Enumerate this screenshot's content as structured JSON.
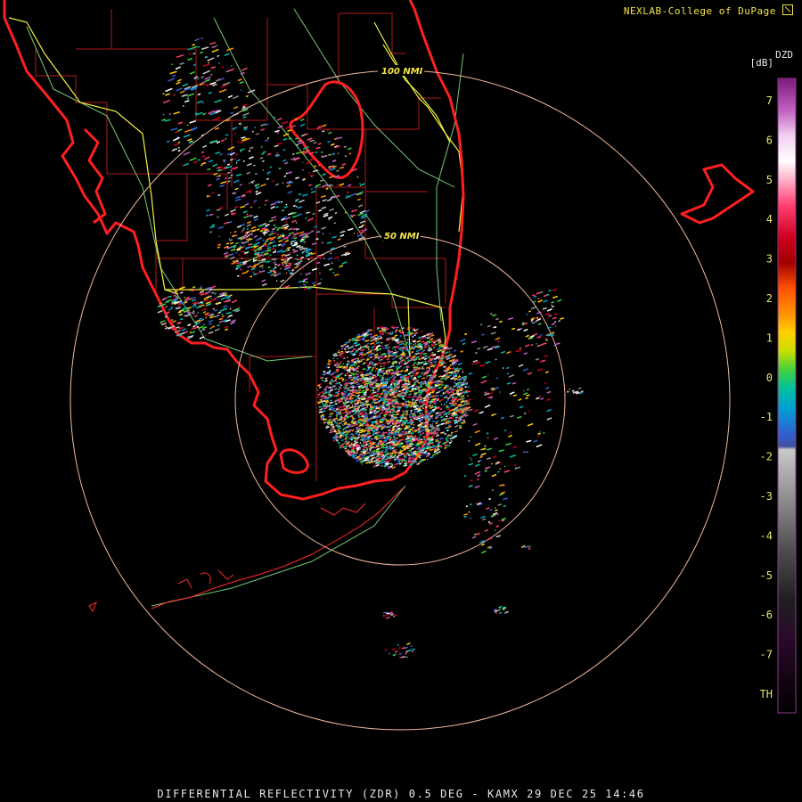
{
  "header": {
    "credit": "NEXLAB-College of DuPage",
    "credit_icon": "cod-arrow-logo-icon"
  },
  "footer": {
    "title": "DIFFERENTIAL REFLECTIVITY (ZDR) 0.5 DEG - KAMX 29 DEC 25 14:46"
  },
  "range_rings": {
    "inner_label": "50 NMI",
    "outer_label": "100 NMI",
    "ring_color": "#f0b8a0"
  },
  "legend": {
    "product": "DZD",
    "unit": "[dB]",
    "ticks": [
      "7",
      "6",
      "5",
      "4",
      "3",
      "2",
      "1",
      "0",
      "-1",
      "-2",
      "-3",
      "-4",
      "-5",
      "-6",
      "-7",
      "TH"
    ],
    "colors": {
      "coast": "#ff2020",
      "county": "#c01818",
      "interstate": "#ffff40",
      "highway": "#80d080"
    }
  }
}
